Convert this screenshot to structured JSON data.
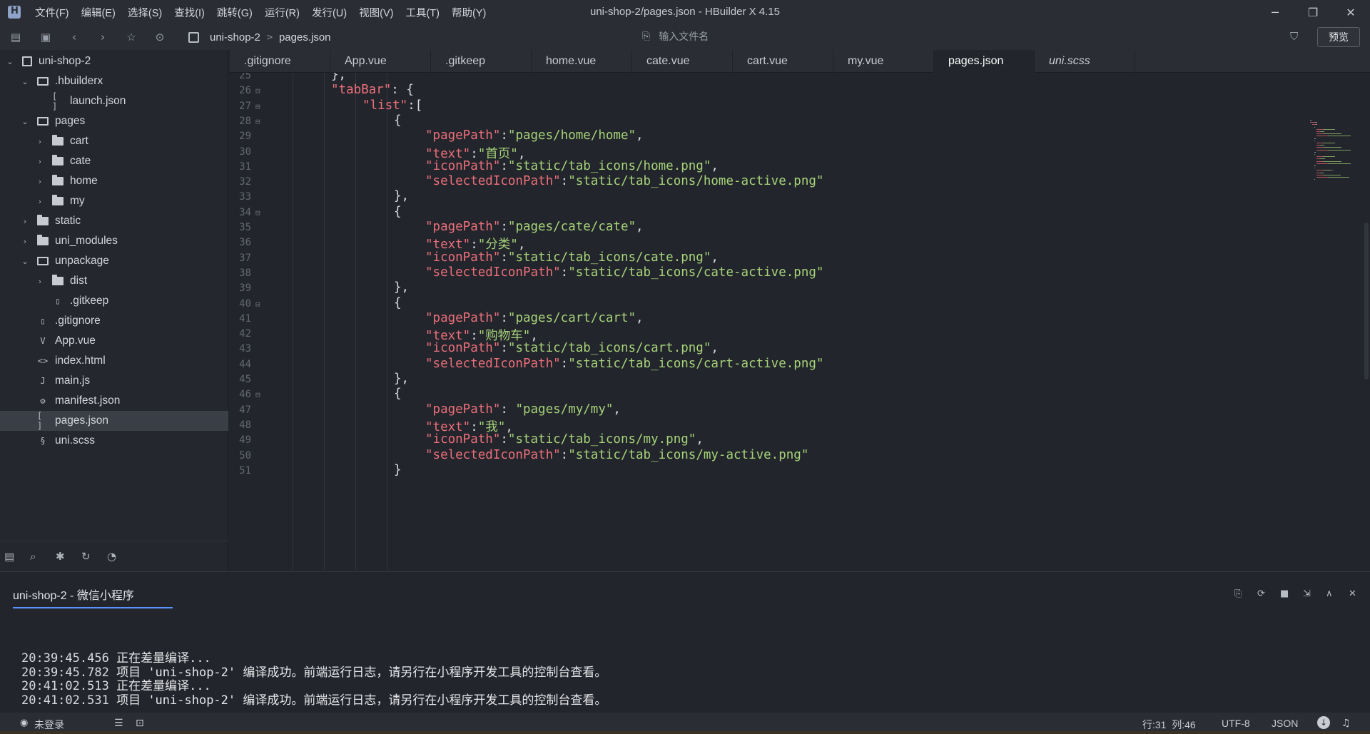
{
  "window": {
    "title": "uni-shop-2/pages.json - HBuilder X 4.15",
    "menu": [
      "文件(F)",
      "编辑(E)",
      "选择(S)",
      "查找(I)",
      "跳转(G)",
      "运行(R)",
      "发行(U)",
      "视图(V)",
      "工具(T)",
      "帮助(Y)"
    ]
  },
  "toolbar": {
    "breadcrumb": [
      "uni-shop-2",
      "pages.json"
    ],
    "file_search_placeholder": "输入文件名",
    "preview_label": "预览"
  },
  "sidebar": {
    "items": [
      {
        "label": "uni-shop-2",
        "depth": 0,
        "kind": "project",
        "expanded": true
      },
      {
        "label": ".hbuilderx",
        "depth": 1,
        "kind": "folder",
        "expanded": true
      },
      {
        "label": "launch.json",
        "depth": 2,
        "kind": "json"
      },
      {
        "label": "pages",
        "depth": 1,
        "kind": "folder",
        "expanded": true
      },
      {
        "label": "cart",
        "depth": 2,
        "kind": "folder",
        "expanded": false
      },
      {
        "label": "cate",
        "depth": 2,
        "kind": "folder",
        "expanded": false
      },
      {
        "label": "home",
        "depth": 2,
        "kind": "folder",
        "expanded": false
      },
      {
        "label": "my",
        "depth": 2,
        "kind": "folder",
        "expanded": false
      },
      {
        "label": "static",
        "depth": 1,
        "kind": "folder",
        "expanded": false
      },
      {
        "label": "uni_modules",
        "depth": 1,
        "kind": "folder",
        "expanded": false
      },
      {
        "label": "unpackage",
        "depth": 1,
        "kind": "folder",
        "expanded": true
      },
      {
        "label": "dist",
        "depth": 2,
        "kind": "folder",
        "expanded": false
      },
      {
        "label": ".gitkeep",
        "depth": 2,
        "kind": "file"
      },
      {
        "label": ".gitignore",
        "depth": 1,
        "kind": "file"
      },
      {
        "label": "App.vue",
        "depth": 1,
        "kind": "vue"
      },
      {
        "label": "index.html",
        "depth": 1,
        "kind": "html"
      },
      {
        "label": "main.js",
        "depth": 1,
        "kind": "js"
      },
      {
        "label": "manifest.json",
        "depth": 1,
        "kind": "manifest"
      },
      {
        "label": "pages.json",
        "depth": 1,
        "kind": "json",
        "selected": true
      },
      {
        "label": "uni.scss",
        "depth": 1,
        "kind": "scss"
      }
    ]
  },
  "tabs": [
    {
      "label": ".gitignore"
    },
    {
      "label": "App.vue"
    },
    {
      "label": ".gitkeep"
    },
    {
      "label": "home.vue"
    },
    {
      "label": "cate.vue"
    },
    {
      "label": "cart.vue"
    },
    {
      "label": "my.vue"
    },
    {
      "label": "pages.json",
      "active": true
    },
    {
      "label": "uni.scss",
      "italic": true
    }
  ],
  "editor": {
    "lines": [
      {
        "n": "25",
        "fold": "",
        "indent": 2,
        "tokens": [
          [
            "p",
            "},"
          ]
        ]
      },
      {
        "n": "26",
        "fold": "⊟",
        "indent": 2,
        "tokens": [
          [
            "k",
            "\"tabBar\""
          ],
          [
            "p",
            ": {"
          ]
        ]
      },
      {
        "n": "27",
        "fold": "⊟",
        "indent": 3,
        "tokens": [
          [
            "k",
            "\"list\""
          ],
          [
            "p",
            ":["
          ]
        ]
      },
      {
        "n": "28",
        "fold": "⊟",
        "indent": 4,
        "tokens": [
          [
            "p",
            "{"
          ]
        ]
      },
      {
        "n": "29",
        "fold": "",
        "indent": 5,
        "tokens": [
          [
            "k",
            "\"pagePath\""
          ],
          [
            "p",
            ":"
          ],
          [
            "s",
            "\"pages/home/home\""
          ],
          [
            "p",
            ","
          ]
        ]
      },
      {
        "n": "30",
        "fold": "",
        "indent": 5,
        "tokens": [
          [
            "k",
            "\"text\""
          ],
          [
            "p",
            ":"
          ],
          [
            "s",
            "\"首页\""
          ],
          [
            "p",
            ","
          ]
        ]
      },
      {
        "n": "31",
        "fold": "",
        "indent": 5,
        "tokens": [
          [
            "k",
            "\"iconPath\""
          ],
          [
            "p",
            ":"
          ],
          [
            "s",
            "\"static/tab_icons/home.png\""
          ],
          [
            "p",
            ","
          ]
        ]
      },
      {
        "n": "32",
        "fold": "",
        "indent": 5,
        "tokens": [
          [
            "k",
            "\"selectedIconPath\""
          ],
          [
            "p",
            ":"
          ],
          [
            "s",
            "\"static/tab_icons/home-active.png\""
          ]
        ]
      },
      {
        "n": "33",
        "fold": "",
        "indent": 4,
        "tokens": [
          [
            "p",
            "},"
          ]
        ]
      },
      {
        "n": "34",
        "fold": "⊟",
        "indent": 4,
        "tokens": [
          [
            "p",
            "{"
          ]
        ]
      },
      {
        "n": "35",
        "fold": "",
        "indent": 5,
        "tokens": [
          [
            "k",
            "\"pagePath\""
          ],
          [
            "p",
            ":"
          ],
          [
            "s",
            "\"pages/cate/cate\""
          ],
          [
            "p",
            ","
          ]
        ]
      },
      {
        "n": "36",
        "fold": "",
        "indent": 5,
        "tokens": [
          [
            "k",
            "\"text\""
          ],
          [
            "p",
            ":"
          ],
          [
            "s",
            "\"分类\""
          ],
          [
            "p",
            ","
          ]
        ]
      },
      {
        "n": "37",
        "fold": "",
        "indent": 5,
        "tokens": [
          [
            "k",
            "\"iconPath\""
          ],
          [
            "p",
            ":"
          ],
          [
            "s",
            "\"static/tab_icons/cate.png\""
          ],
          [
            "p",
            ","
          ]
        ]
      },
      {
        "n": "38",
        "fold": "",
        "indent": 5,
        "tokens": [
          [
            "k",
            "\"selectedIconPath\""
          ],
          [
            "p",
            ":"
          ],
          [
            "s",
            "\"static/tab_icons/cate-active.png\""
          ]
        ]
      },
      {
        "n": "39",
        "fold": "",
        "indent": 4,
        "tokens": [
          [
            "p",
            "},"
          ]
        ]
      },
      {
        "n": "40",
        "fold": "⊟",
        "indent": 4,
        "tokens": [
          [
            "p",
            "{"
          ]
        ]
      },
      {
        "n": "41",
        "fold": "",
        "indent": 5,
        "tokens": [
          [
            "k",
            "\"pagePath\""
          ],
          [
            "p",
            ":"
          ],
          [
            "s",
            "\"pages/cart/cart\""
          ],
          [
            "p",
            ","
          ]
        ]
      },
      {
        "n": "42",
        "fold": "",
        "indent": 5,
        "tokens": [
          [
            "k",
            "\"text\""
          ],
          [
            "p",
            ":"
          ],
          [
            "s",
            "\"购物车\""
          ],
          [
            "p",
            ","
          ]
        ]
      },
      {
        "n": "43",
        "fold": "",
        "indent": 5,
        "tokens": [
          [
            "k",
            "\"iconPath\""
          ],
          [
            "p",
            ":"
          ],
          [
            "s",
            "\"static/tab_icons/cart.png\""
          ],
          [
            "p",
            ","
          ]
        ]
      },
      {
        "n": "44",
        "fold": "",
        "indent": 5,
        "tokens": [
          [
            "k",
            "\"selectedIconPath\""
          ],
          [
            "p",
            ":"
          ],
          [
            "s",
            "\"static/tab_icons/cart-active.png\""
          ]
        ]
      },
      {
        "n": "45",
        "fold": "",
        "indent": 4,
        "tokens": [
          [
            "p",
            "},"
          ]
        ]
      },
      {
        "n": "46",
        "fold": "⊟",
        "indent": 4,
        "tokens": [
          [
            "p",
            "{"
          ]
        ]
      },
      {
        "n": "47",
        "fold": "",
        "indent": 5,
        "tokens": [
          [
            "k",
            "\"pagePath\""
          ],
          [
            "p",
            ": "
          ],
          [
            "s",
            "\"pages/my/my\""
          ],
          [
            "p",
            ","
          ]
        ]
      },
      {
        "n": "48",
        "fold": "",
        "indent": 5,
        "tokens": [
          [
            "k",
            "\"text\""
          ],
          [
            "p",
            ":"
          ],
          [
            "s",
            "\"我\""
          ],
          [
            "p",
            ","
          ]
        ]
      },
      {
        "n": "49",
        "fold": "",
        "indent": 5,
        "tokens": [
          [
            "k",
            "\"iconPath\""
          ],
          [
            "p",
            ":"
          ],
          [
            "s",
            "\"static/tab_icons/my.png\""
          ],
          [
            "p",
            ","
          ]
        ]
      },
      {
        "n": "50",
        "fold": "",
        "indent": 5,
        "tokens": [
          [
            "k",
            "\"selectedIconPath\""
          ],
          [
            "p",
            ":"
          ],
          [
            "s",
            "\"static/tab_icons/my-active.png\""
          ]
        ]
      },
      {
        "n": "51",
        "fold": "",
        "indent": 4,
        "tokens": [
          [
            "p",
            "}"
          ]
        ]
      }
    ]
  },
  "console": {
    "tab_label": "uni-shop-2 - 微信小程序",
    "logs": [
      {
        "time": "20:39:45.456",
        "msg": "正在差量编译..."
      },
      {
        "time": "20:39:45.782",
        "msg": "项目 'uni-shop-2' 编译成功。前端运行日志，请另行在小程序开发工具的控制台查看。"
      },
      {
        "time": "20:41:02.513",
        "msg": "正在差量编译..."
      },
      {
        "time": "20:41:02.531",
        "msg": "项目 'uni-shop-2' 编译成功。前端运行日志，请另行在小程序开发工具的控制台查看。"
      }
    ]
  },
  "status": {
    "login": "未登录",
    "position": "行:31  列:46",
    "encoding": "UTF-8",
    "language": "JSON"
  }
}
